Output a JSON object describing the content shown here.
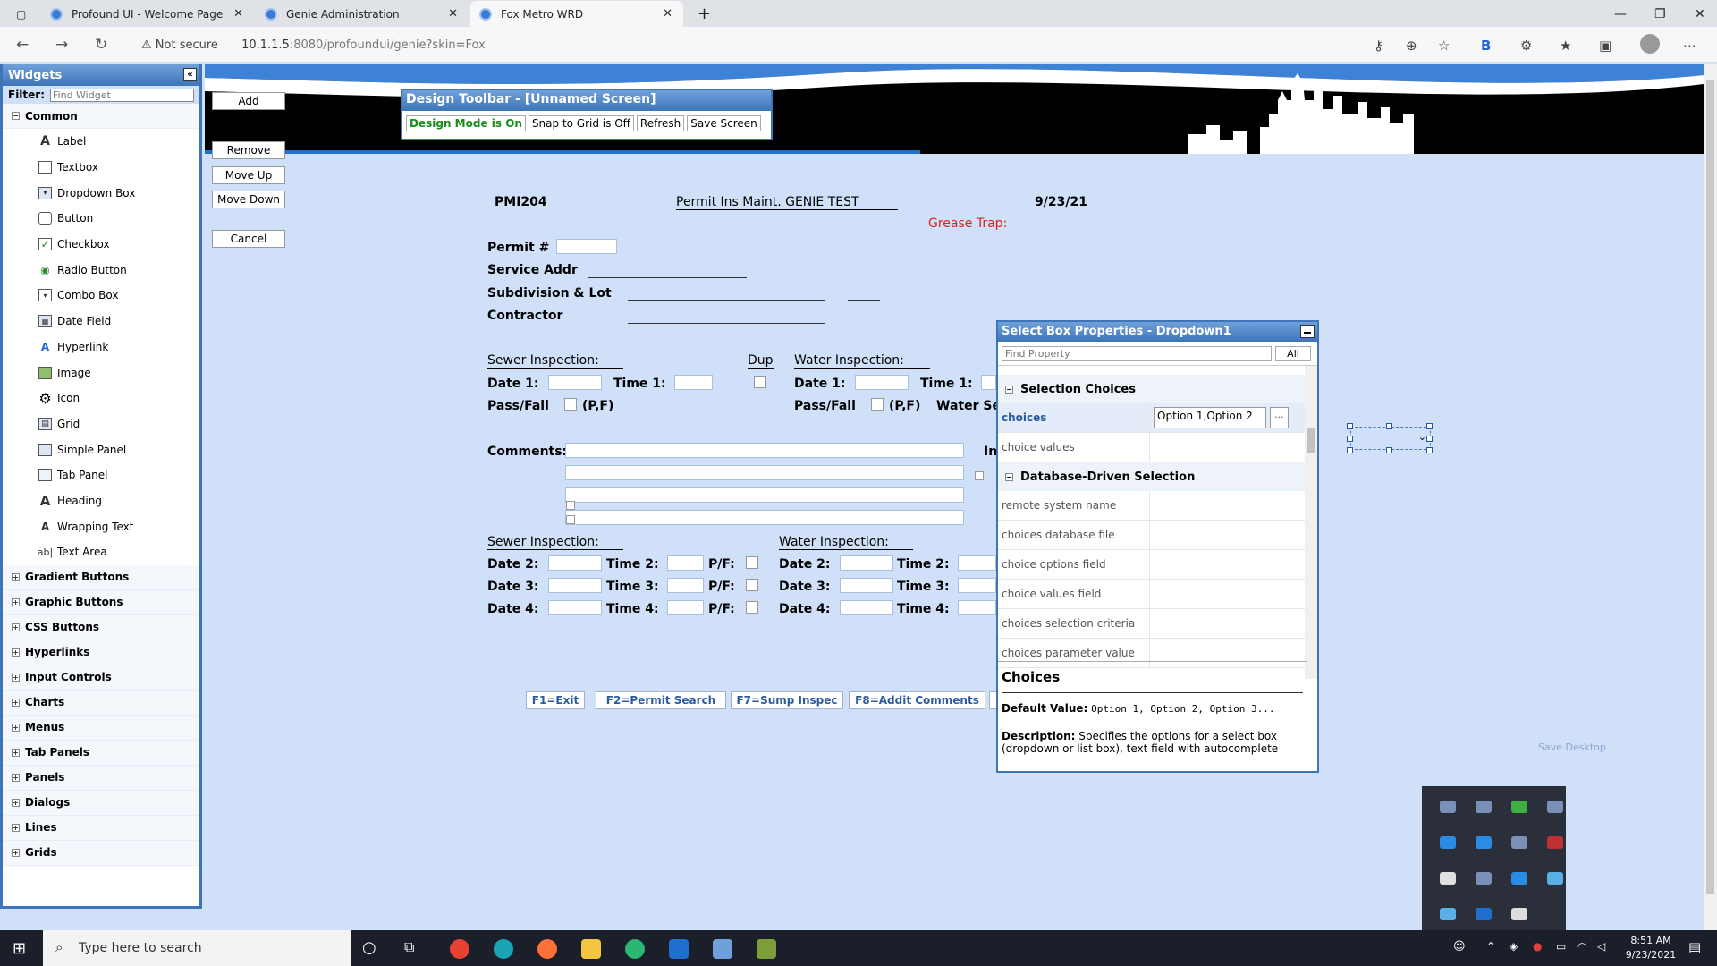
{
  "browser": {
    "tabs": [
      {
        "title": "Profound UI - Welcome Page",
        "close": "✕"
      },
      {
        "title": "Genie Administration",
        "close": "✕"
      },
      {
        "title": "Fox Metro WRD",
        "close": "✕"
      }
    ],
    "new_tab": "+",
    "not_secure": "Not secure",
    "url_host": "10.1.1.5",
    "url_path": ":8080/profoundui/genie?skin=Fox",
    "profile_letter": "B",
    "menu": "⋯"
  },
  "widgets": {
    "title": "Widgets",
    "collapse": "«",
    "filter_label": "Filter:",
    "filter_placeholder": "Find Widget",
    "common_label": "Common",
    "items": [
      "Label",
      "Textbox",
      "Dropdown Box",
      "Button",
      "Checkbox",
      "Radio Button",
      "Combo Box",
      "Date Field",
      "Hyperlink",
      "Image",
      "Icon",
      "Grid",
      "Simple Panel",
      "Tab Panel",
      "Heading",
      "Wrapping Text",
      "Text Area"
    ],
    "categories": [
      "Gradient Buttons",
      "Graphic Buttons",
      "CSS Buttons",
      "Hyperlinks",
      "Input Controls",
      "Charts",
      "Menus",
      "Tab Panels",
      "Panels",
      "Dialogs",
      "Lines",
      "Grids"
    ]
  },
  "side_buttons": {
    "add": "Add",
    "remove": "Remove",
    "move_up": "Move Up",
    "move_down": "Move Down",
    "cancel": "Cancel"
  },
  "design_toolbar": {
    "title": "Design Toolbar - [Unnamed Screen]",
    "design_mode": "Design Mode is On",
    "snap": "Snap to Grid is Off",
    "refresh": "Refresh",
    "save": "Save Screen"
  },
  "screen": {
    "program": "PMI204",
    "title": "Permit Ins Maint. GENIE TEST",
    "date": "9/23/21",
    "grease_trap": "Grease Trap:",
    "permit": "Permit #",
    "service_addr": "Service Addr",
    "subdivision": "Subdivision & Lot",
    "contractor": "Contractor",
    "sewer_insp": "Sewer Inspection:",
    "dup": "Dup",
    "water_insp": "Water Inspection:",
    "date1": "Date 1:",
    "time1": "Time 1:",
    "pass_fail": "Pass/Fail",
    "pf_hint": "(P,F)",
    "water_ser": "Water Ser",
    "comments": "Comments:",
    "in_label": "In",
    "date2": "Date 2:",
    "time2": "Time 2:",
    "date3": "Date 3:",
    "time3": "Time 3:",
    "date4": "Date 4:",
    "time4": "Time 4:",
    "pf_colon": "P/F:",
    "fkeys": [
      "F1=Exit",
      "F2=Permit Search",
      "F7=Sump Inspec",
      "F8=Addit Comments"
    ],
    "save_desktop": "Save Desktop"
  },
  "properties": {
    "title": "Select Box Properties - Dropdown1",
    "find_placeholder": "Find Property",
    "all": "All",
    "section1": "Selection Choices",
    "choices_key": "choices",
    "choices_value": "Option 1,Option 2",
    "ellipsis": "...",
    "choice_values": "choice values",
    "section2": "Database-Driven Selection",
    "rows": [
      "remote system name",
      "choices database file",
      "choice options field",
      "choice values field",
      "choices selection criteria",
      "choices parameter value"
    ],
    "desc_title": "Choices",
    "default_label": "Default Value:",
    "default_value": "Option 1, Option 2, Option 3...",
    "desc_label": "Description:",
    "desc_text": "Specifies the options for a select box (dropdown or list box), text field with autocomplete"
  },
  "taskbar": {
    "search_placeholder": "Type here to search",
    "time": "8:51 AM",
    "date": "9/23/2021"
  }
}
